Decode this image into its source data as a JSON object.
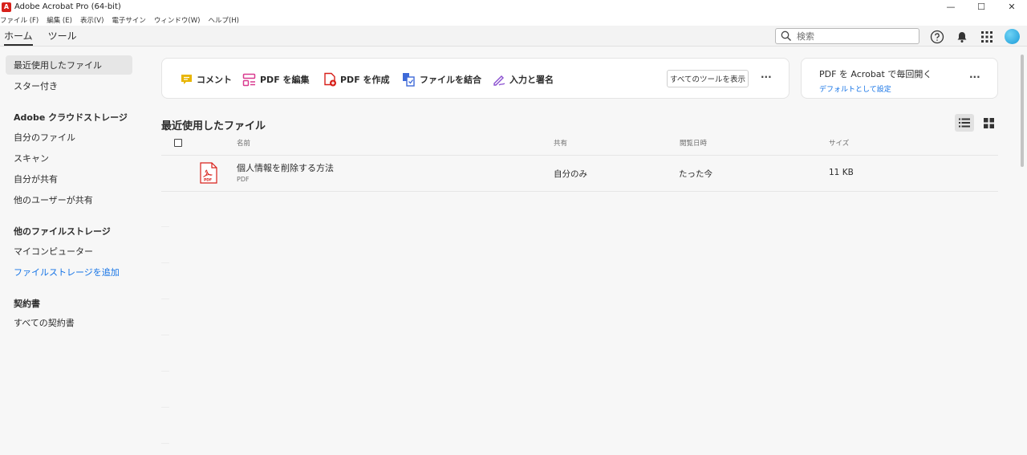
{
  "window": {
    "title": "Adobe Acrobat Pro (64-bit)",
    "logo_letter": "A",
    "minimize_glyph": "—",
    "maximize_glyph": "☐",
    "close_glyph": "✕"
  },
  "menubar": [
    "ファイル (F)",
    "編集 (E)",
    "表示(V)",
    "電子サイン",
    "ウィンドウ(W)",
    "ヘルプ(H)"
  ],
  "topnav": {
    "tabs": [
      {
        "label": "ホーム",
        "active": true
      },
      {
        "label": "ツール",
        "active": false
      }
    ],
    "search_placeholder": "検索"
  },
  "sidebar": {
    "recent": "最近使用したファイル",
    "starred": "スター付き",
    "cloud_heading": "Adobe クラウドストレージ",
    "my_files": "自分のファイル",
    "scan": "スキャン",
    "shared_by_me": "自分が共有",
    "shared_by_others": "他のユーザーが共有",
    "other_heading": "他のファイルストレージ",
    "my_computer": "マイコンピューター",
    "add_storage": "ファイルストレージを追加",
    "agreements_heading": "契約書",
    "all_agreements": "すべての契約書"
  },
  "tools": {
    "comment": "コメント",
    "edit_pdf": "PDF を編集",
    "create_pdf": "PDF を作成",
    "combine": "ファイルを結合",
    "fill_sign": "入力と署名",
    "show_all": "すべてのツールを表示",
    "more": "···"
  },
  "default_card": {
    "title": "PDF を Acrobat で毎回開く",
    "link": "デフォルトとして設定",
    "more": "···"
  },
  "recent": {
    "title": "最近使用したファイル",
    "columns": {
      "name": "名前",
      "shared": "共有",
      "opened": "閲覧日時",
      "size": "サイズ"
    },
    "files": [
      {
        "name": "個人情報を削除する方法",
        "type": "PDF",
        "shared": "自分のみ",
        "opened": "たった今",
        "size": "11 KB"
      }
    ]
  },
  "colors": {
    "accent_link": "#1473e6",
    "pdf_red": "#d7201a",
    "comment_yellow": "#e8b500",
    "edit_pink": "#d93a8f",
    "combine_blue": "#3e6ad8",
    "sign_purple": "#8a4fd0"
  }
}
